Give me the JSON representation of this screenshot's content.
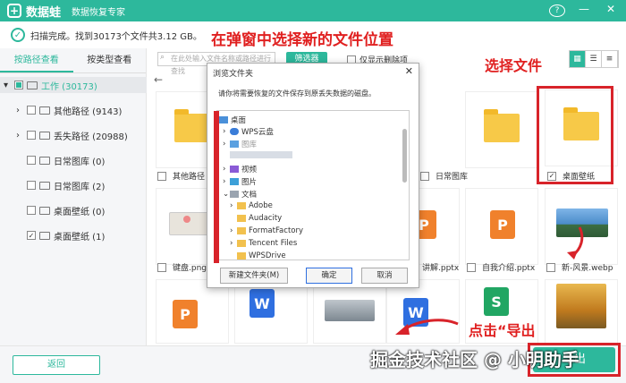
{
  "app": {
    "name": "数据蛙",
    "subtitle": "数据恢复专家"
  },
  "scan": {
    "text": "扫描完成。找到30173个文件共3.12 GB。"
  },
  "annotations": {
    "top": "在弹窗中选择新的文件位置",
    "select_file": "选择文件",
    "click_export": "点击“导出"
  },
  "left_tabs": [
    "按路径查看",
    "按类型查看"
  ],
  "tree": [
    {
      "label": "工作 (30173)"
    },
    {
      "label": "其他路径 (9143)"
    },
    {
      "label": "丢失路径 (20988)"
    },
    {
      "label": "日常图库 (0)"
    },
    {
      "label": "日常图库 (2)"
    },
    {
      "label": "桌面壁纸 (0)"
    },
    {
      "label": "桌面壁纸 (1)"
    }
  ],
  "toolbar": {
    "search_placeholder": "在此处输入文件名称或路径进行查找",
    "filter": "筛选器",
    "only_deleted": "仅显示删除项"
  },
  "cards": {
    "r1": [
      "其他路径",
      "日常图库",
      "桌面壁纸"
    ],
    "r2": [
      "键盘.png",
      "讲解.pptx",
      "自我介绍.pptx",
      "新-风景.webp"
    ]
  },
  "dialog": {
    "title": "浏览文件夹",
    "desc": "请你将需要恢复的文件保存到原丢失数据的磁盘。",
    "tree": [
      "桌面",
      "WPS云盘",
      "图库",
      "视频",
      "图片",
      "文档",
      "Adobe",
      "Audacity",
      "FormatFactory",
      "Tencent Files",
      "WPSDrive"
    ],
    "new_folder": "新建文件夹(M)",
    "ok": "确定",
    "cancel": "取消"
  },
  "bottom": {
    "back": "返回",
    "export": "导出"
  },
  "watermark": "掘金技术社区 @ 小明助手",
  "colors": {
    "brand": "#2db89c",
    "annotation": "#d8232a"
  }
}
